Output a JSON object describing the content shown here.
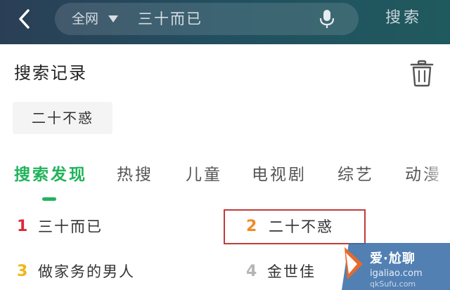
{
  "header": {
    "scope_label": "全网",
    "search_query": "三十而已",
    "search_button_label": "搜索"
  },
  "history": {
    "title": "搜索记录",
    "items": [
      {
        "label": "二十不惑"
      }
    ]
  },
  "tabs": [
    {
      "label": "搜索发现",
      "active": true
    },
    {
      "label": "热搜",
      "active": false
    },
    {
      "label": "儿童",
      "active": false
    },
    {
      "label": "电视剧",
      "active": false
    },
    {
      "label": "综艺",
      "active": false
    },
    {
      "label": "动漫",
      "active": false
    }
  ],
  "discover": {
    "items": [
      {
        "rank": "1",
        "label": "三十而已",
        "rank_color": "#d92b3a"
      },
      {
        "rank": "2",
        "label": "二十不惑",
        "rank_color": "#f08a28"
      },
      {
        "rank": "3",
        "label": "做家务的男人",
        "rank_color": "#f2b418"
      },
      {
        "rank": "4",
        "label": "金世佳",
        "rank_color": "#b5b5b5"
      }
    ]
  },
  "watermark": {
    "text": "爱·尬聊",
    "url": "igaliao.com",
    "extra": "qkSufu.com"
  },
  "colors": {
    "accent": "#22b35c",
    "highlight_border": "#c23b3b"
  }
}
